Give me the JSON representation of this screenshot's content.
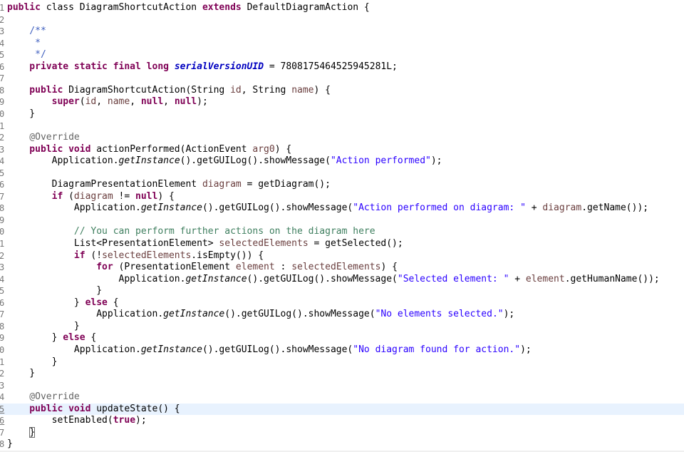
{
  "editor": {
    "current_line": 35,
    "lines": [
      {
        "n": "1",
        "t": [
          [
            "k",
            "public"
          ],
          [
            "",
            "class"
          ],
          [
            "",
            "DiagramShortcutAction"
          ],
          [
            "k",
            "extends"
          ],
          [
            "",
            "DefaultDiagramAction {"
          ]
        ]
      },
      {
        "n": "2",
        "t": []
      },
      {
        "n": "3",
        "t": [
          [
            "cd",
            "    /**"
          ]
        ]
      },
      {
        "n": "4",
        "t": [
          [
            "cd",
            "     *"
          ]
        ]
      },
      {
        "n": "5",
        "t": [
          [
            "cd",
            "     */"
          ]
        ]
      },
      {
        "n": "6",
        "t": [
          [
            "k",
            "    private static final long "
          ],
          [
            "f",
            "serialVersionUID"
          ],
          [
            "",
            " = 7808175464525945281L;"
          ]
        ]
      },
      {
        "n": "7",
        "t": []
      },
      {
        "n": "8",
        "t": [
          [
            "k",
            "    public "
          ],
          [
            "",
            "DiagramShortcutAction(String "
          ],
          [
            "v",
            "id"
          ],
          [
            "",
            ", String "
          ],
          [
            "v",
            "name"
          ],
          [
            "",
            ") {"
          ]
        ]
      },
      {
        "n": "9",
        "t": [
          [
            "k",
            "        super"
          ],
          [
            "",
            "("
          ],
          [
            "v",
            "id"
          ],
          [
            "",
            ", "
          ],
          [
            "v",
            "name"
          ],
          [
            "",
            ", "
          ],
          [
            "k",
            "null"
          ],
          [
            "",
            ", "
          ],
          [
            "k",
            "null"
          ],
          [
            "",
            ");"
          ]
        ]
      },
      {
        "n": "0",
        "t": [
          [
            "",
            "    }"
          ]
        ]
      },
      {
        "n": "1",
        "t": []
      },
      {
        "n": "2",
        "t": [
          [
            "a",
            "    @Override"
          ]
        ]
      },
      {
        "n": "3",
        "t": [
          [
            "k",
            "    public void "
          ],
          [
            "",
            "actionPerformed(ActionEvent "
          ],
          [
            "v",
            "arg0"
          ],
          [
            "",
            ") {"
          ]
        ]
      },
      {
        "n": "4",
        "t": [
          [
            "",
            "        Application."
          ],
          [
            "st",
            "getInstance"
          ],
          [
            "",
            "().getGUILog().showMessage("
          ],
          [
            "s",
            "\"Action performed\""
          ],
          [
            "",
            ");"
          ]
        ]
      },
      {
        "n": "5",
        "t": []
      },
      {
        "n": "6",
        "t": [
          [
            "",
            "        DiagramPresentationElement "
          ],
          [
            "v",
            "diagram"
          ],
          [
            "",
            " = getDiagram();"
          ]
        ]
      },
      {
        "n": "7",
        "t": [
          [
            "k",
            "        if "
          ],
          [
            "",
            "("
          ],
          [
            "v",
            "diagram"
          ],
          [
            "",
            " != "
          ],
          [
            "k",
            "null"
          ],
          [
            "",
            ") {"
          ]
        ]
      },
      {
        "n": "8",
        "t": [
          [
            "",
            "            Application."
          ],
          [
            "st",
            "getInstance"
          ],
          [
            "",
            "().getGUILog().showMessage("
          ],
          [
            "s",
            "\"Action performed on diagram: \""
          ],
          [
            "",
            " + "
          ],
          [
            "v",
            "diagram"
          ],
          [
            "",
            ".getName());"
          ]
        ]
      },
      {
        "n": "9",
        "t": []
      },
      {
        "n": "0",
        "t": [
          [
            "c",
            "            // You can perform further actions on the diagram here"
          ]
        ]
      },
      {
        "n": "1",
        "t": [
          [
            "",
            "            List<PresentationElement> "
          ],
          [
            "v",
            "selectedElements"
          ],
          [
            "",
            " = getSelected();"
          ]
        ]
      },
      {
        "n": "2",
        "t": [
          [
            "k",
            "            if "
          ],
          [
            "",
            "(!"
          ],
          [
            "v",
            "selectedElements"
          ],
          [
            "",
            ".isEmpty()) {"
          ]
        ]
      },
      {
        "n": "3",
        "t": [
          [
            "k",
            "                for "
          ],
          [
            "",
            "(PresentationElement "
          ],
          [
            "v",
            "element"
          ],
          [
            "",
            " : "
          ],
          [
            "v",
            "selectedElements"
          ],
          [
            "",
            ") {"
          ]
        ]
      },
      {
        "n": "4",
        "t": [
          [
            "",
            "                    Application."
          ],
          [
            "st",
            "getInstance"
          ],
          [
            "",
            "().getGUILog().showMessage("
          ],
          [
            "s",
            "\"Selected element: \""
          ],
          [
            "",
            " + "
          ],
          [
            "v",
            "element"
          ],
          [
            "",
            ".getHumanName());"
          ]
        ]
      },
      {
        "n": "5",
        "t": [
          [
            "",
            "                }"
          ]
        ]
      },
      {
        "n": "6",
        "t": [
          [
            "",
            "            } "
          ],
          [
            "k",
            "else "
          ],
          [
            "",
            "{"
          ]
        ]
      },
      {
        "n": "7",
        "t": [
          [
            "",
            "                Application."
          ],
          [
            "st",
            "getInstance"
          ],
          [
            "",
            "().getGUILog().showMessage("
          ],
          [
            "s",
            "\"No elements selected.\""
          ],
          [
            "",
            ");"
          ]
        ]
      },
      {
        "n": "8",
        "t": [
          [
            "",
            "            }"
          ]
        ]
      },
      {
        "n": "9",
        "t": [
          [
            "",
            "        } "
          ],
          [
            "k",
            "else "
          ],
          [
            "",
            "{"
          ]
        ]
      },
      {
        "n": "0",
        "t": [
          [
            "",
            "            Application."
          ],
          [
            "st",
            "getInstance"
          ],
          [
            "",
            "().getGUILog().showMessage("
          ],
          [
            "s",
            "\"No diagram found for action.\""
          ],
          [
            "",
            ");"
          ]
        ]
      },
      {
        "n": "1",
        "t": [
          [
            "",
            "        }"
          ]
        ]
      },
      {
        "n": "2",
        "t": [
          [
            "",
            "    }"
          ]
        ]
      },
      {
        "n": "3",
        "t": []
      },
      {
        "n": "4",
        "t": [
          [
            "a",
            "    @Override"
          ]
        ]
      },
      {
        "n": "5",
        "t": [
          [
            "k",
            "    public void "
          ],
          [
            "",
            "updateState() {"
          ]
        ]
      },
      {
        "n": "6",
        "t": [
          [
            "",
            "        setEnabled("
          ],
          [
            "k",
            "true"
          ],
          [
            "",
            ");"
          ]
        ]
      },
      {
        "n": "7",
        "t": [
          [
            "",
            "    "
          ],
          [
            "bm",
            "}"
          ]
        ]
      },
      {
        "n": "8",
        "t": [
          [
            "",
            "}"
          ]
        ]
      }
    ]
  }
}
